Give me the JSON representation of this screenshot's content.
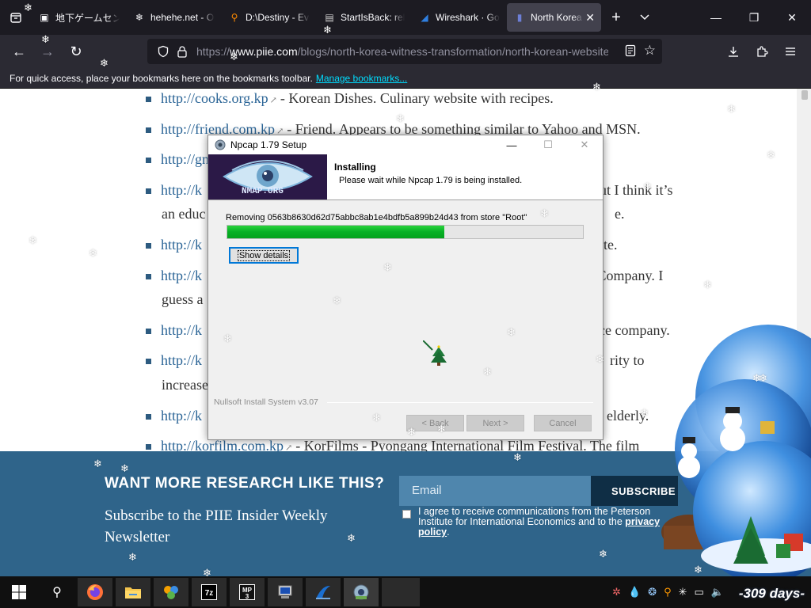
{
  "browser": {
    "tabs": [
      {
        "title": "地下ゲームセンター",
        "icon": "page-icon",
        "active": false
      },
      {
        "title": "hehehe.net - Online",
        "icon": "snowflake-icon",
        "active": false
      },
      {
        "title": "D:\\Destiny - Everything",
        "icon": "search-icon",
        "active": false
      },
      {
        "title": "StartIsBack: release",
        "icon": "startisback-icon",
        "active": false
      },
      {
        "title": "Wireshark · Go Deep",
        "icon": "wireshark-icon",
        "active": false
      },
      {
        "title": "North Korea",
        "icon": "shield-icon",
        "active": true
      }
    ],
    "url_prefix": "https://",
    "url_host": "www.piie.com",
    "url_path": "/blogs/north-korea-witness-transformation/north-korean-website",
    "bookmarks_text": "For quick access, place your bookmarks here on the bookmarks toolbar.",
    "bookmarks_link": "Manage bookmarks..."
  },
  "page": {
    "links": [
      {
        "url": "http://cooks.org.kp",
        "text": "- Korean Dishes. Culinary website with recipes."
      },
      {
        "url": "http://friend.com.kp",
        "text": "- Friend. Appears to be something similar to Yahoo and MSN."
      },
      {
        "url": "http://gnu.rep.kp",
        "text": ""
      },
      {
        "url": "http://k",
        "text": "ut I think it’s"
      },
      {
        "url": "",
        "text": "an educ",
        "tail": "e."
      },
      {
        "url": "http://k",
        "text": "ite."
      },
      {
        "url": "http://k",
        "text": "el Company. I"
      },
      {
        "url": "",
        "text": "guess a",
        "tail": ""
      },
      {
        "url": "http://k",
        "text": "ce company."
      },
      {
        "url": "http://k",
        "text": "rity to"
      },
      {
        "url": "",
        "text": "increase",
        "tail": ""
      },
      {
        "url": "http://k",
        "text": "elderly."
      },
      {
        "url": "http://korfilm.com.kp",
        "text": "- KorFilms - Pyongang International Film Festival. The film"
      }
    ],
    "newsletter": {
      "title": "WANT MORE RESEARCH LIKE THIS?",
      "subtitle": "Subscribe to the PIIE Insider Weekly Newsletter",
      "email_placeholder": "Email",
      "subscribe_label": "SUBSCRIBE",
      "agree_text": "I agree to receive communications from the Peterson Institute for International Economics and to the",
      "agree_link": "privacy policy"
    }
  },
  "installer": {
    "window_title": "Npcap 1.79 Setup",
    "logo_text": "NMAP.ORG",
    "header_title": "Installing",
    "header_subtitle": "Please wait while Npcap 1.79 is being installed.",
    "status": "Removing 0563b8630d62d75abbc8ab1e4bdfb5a899b24d43 from store \"Root\"",
    "progress": 0.61,
    "show_details": "Show details",
    "brand": "Nullsoft Install System v3.07",
    "back": "< Back",
    "next": "Next >",
    "cancel": "Cancel"
  },
  "taskbar": {
    "days_counter": "-309 days-"
  },
  "colors": {
    "accent": "#0078d7",
    "progress": "#06b025",
    "newsletter_bg": "#2f648a",
    "link": "#2a6496"
  }
}
